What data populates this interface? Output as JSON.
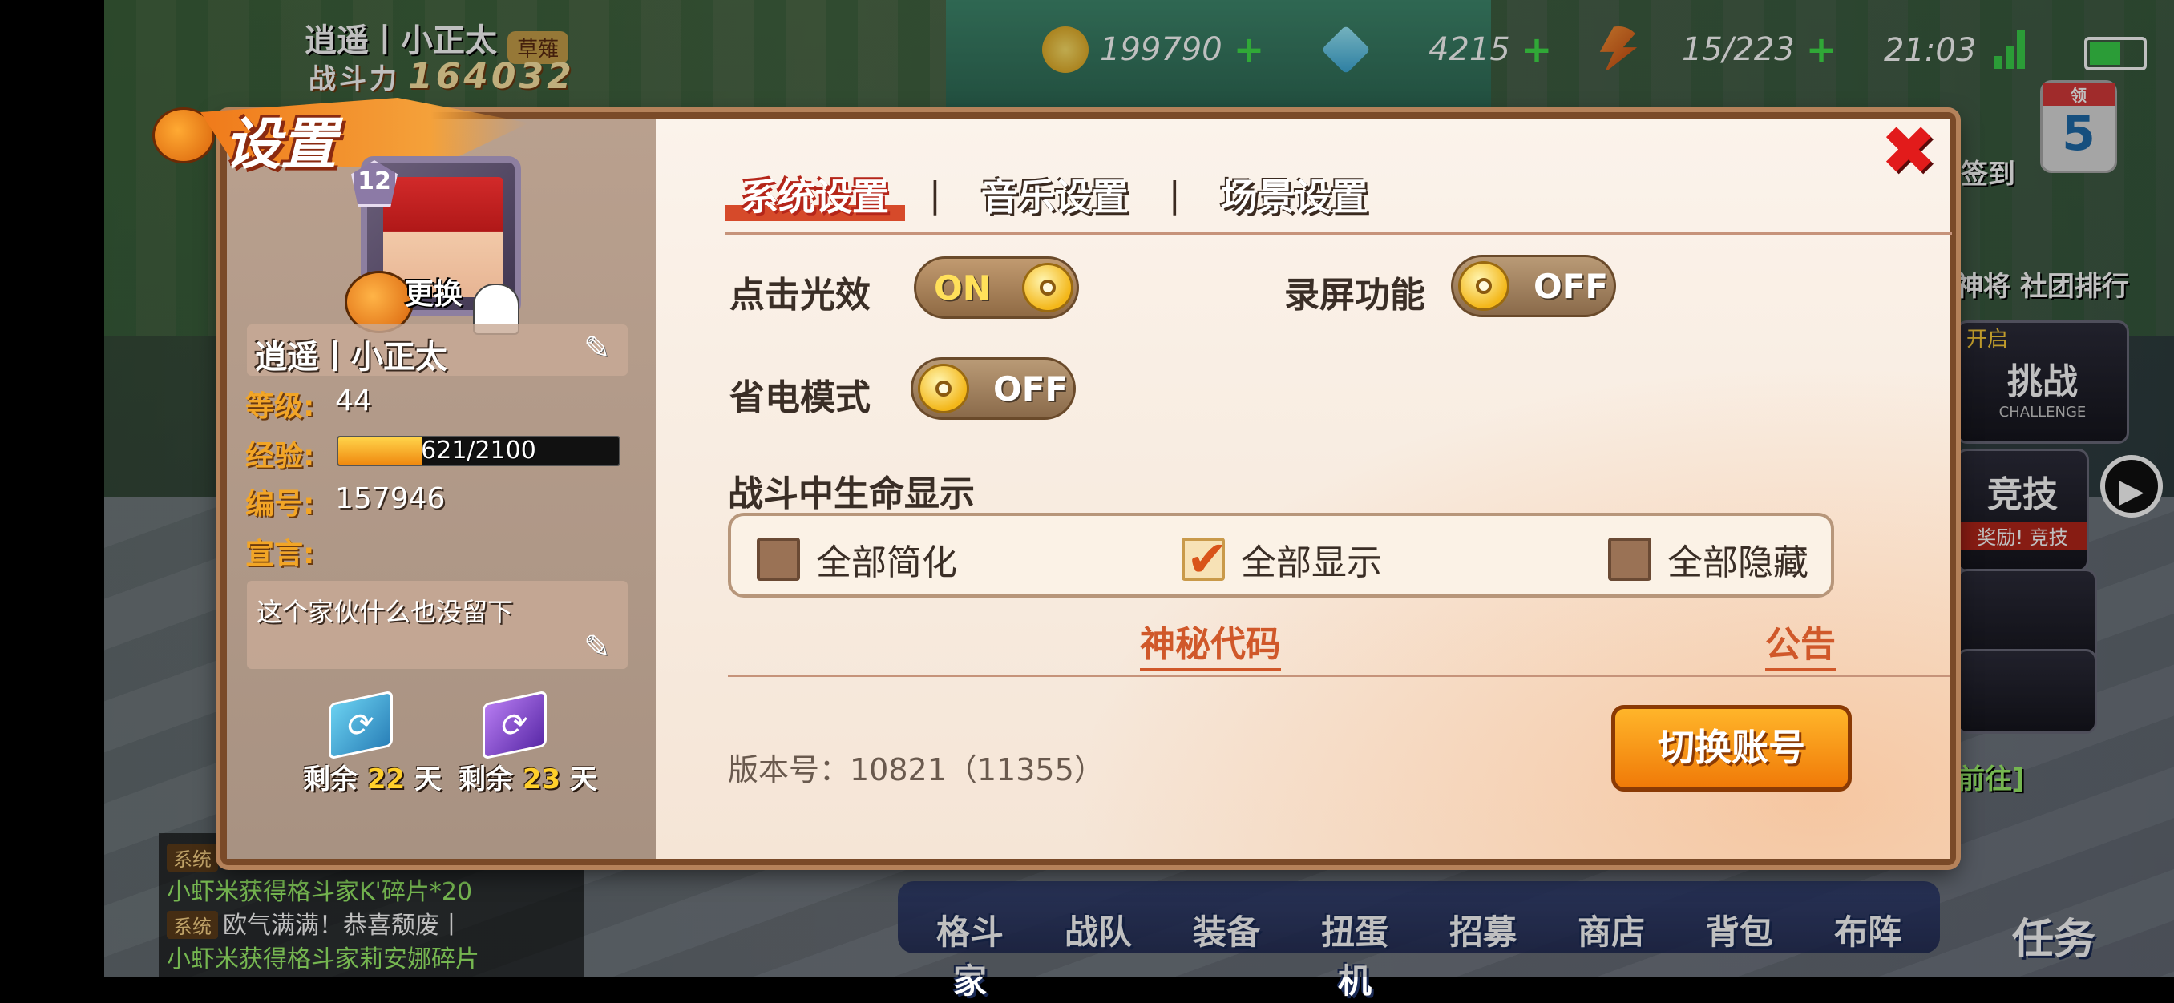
{
  "hud": {
    "player_name": "逍遥丨小正太",
    "badge": "草薙",
    "power_label": "战斗力",
    "power_value": "164032",
    "gold": "199790",
    "diamonds": "4215",
    "stamina": "15/223",
    "time": "21:03"
  },
  "modal": {
    "title": "设置",
    "close_symbol": "✖",
    "tabs": [
      "系统设置",
      "音乐设置",
      "场景设置"
    ],
    "tab_separator": "|",
    "active_tab": 0
  },
  "profile": {
    "level_badge": "12",
    "change_avatar": "更换",
    "name": "逍遥丨小正太",
    "level_label": "等级:",
    "level_value": "44",
    "exp_label": "经验:",
    "exp_text": "621/2100",
    "exp_fraction": 0.296,
    "id_label": "编号:",
    "id_value": "157946",
    "motto_label": "宣言:",
    "motto_text": "这个家伙什么也没留下",
    "card1_prefix": "剩余",
    "card1_days": "22",
    "card1_suffix": "天",
    "card2_prefix": "剩余",
    "card2_days": "23",
    "card2_suffix": "天"
  },
  "settings": {
    "click_effect_label": "点击光效",
    "click_effect_state": "ON",
    "record_label": "录屏功能",
    "record_state": "OFF",
    "power_save_label": "省电模式",
    "power_save_state": "OFF",
    "hp_display_label": "战斗中生命显示",
    "hp_options": [
      {
        "label": "全部简化",
        "checked": false
      },
      {
        "label": "全部显示",
        "checked": true
      },
      {
        "label": "全部隐藏",
        "checked": false
      }
    ],
    "secret_code_link": "神秘代码",
    "notice_link": "公告",
    "version": "版本号：10821（11355）",
    "switch_account": "切换账号"
  },
  "side_menu": {
    "checkin": "签到",
    "sign": "神将",
    "club_rank": "社团排行",
    "open": "开启",
    "challenge": "挑战",
    "challenge_en": "CHALLENGE",
    "arena": "竞技",
    "reward_prefix": "奖励!",
    "arena_small": "竞技",
    "goto": "前往]",
    "receive": "领",
    "count": "5"
  },
  "bottom_nav": [
    "格斗家",
    "战队",
    "装备",
    "扭蛋机",
    "招募",
    "商店",
    "背包",
    "布阵"
  ],
  "task_button": "任务",
  "chat": [
    {
      "tag": "系统",
      "text": "欧气满满！恭喜颓废丨"
    },
    {
      "tag": "",
      "text": "小虾米获得格斗家K'碎片*20"
    },
    {
      "tag": "系统",
      "text": "欧气满满！恭喜颓废丨"
    },
    {
      "tag": "",
      "text": "小虾米获得格斗家莉安娜碎片"
    }
  ],
  "colors": {
    "accent_orange": "#f07a08",
    "link_red": "#d0582a",
    "toggle_gold": "#f3b71a"
  }
}
